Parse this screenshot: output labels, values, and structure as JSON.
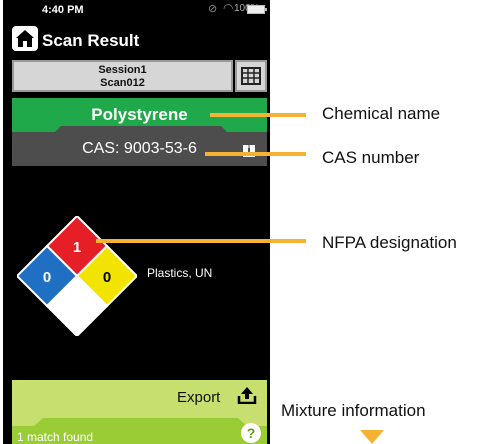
{
  "status_bar": {
    "time": "4:40 PM",
    "battery": "100%"
  },
  "header": {
    "title": "Scan Result"
  },
  "session": {
    "line1": "Session1",
    "line2": "Scan012"
  },
  "result": {
    "chemical_name": "Polystyrene",
    "cas": "CAS: 9003-53-6",
    "info_icon": "i"
  },
  "nfpa": {
    "health": "0",
    "flammability": "1",
    "instability": "0",
    "special": "",
    "label": "Plastics, UN",
    "colors": {
      "health": "#1f6fc2",
      "flammability": "#e61e25",
      "instability": "#f2e400",
      "special": "#ffffff"
    }
  },
  "footer": {
    "export_label": "Export",
    "match_text": "1 match found",
    "help_icon": "?"
  },
  "annotations": {
    "chemical_name": "Chemical name",
    "cas_number": "CAS number",
    "nfpa": "NFPA designation",
    "mixture": "Mixture information"
  },
  "colors": {
    "annotation_line": "#f6b232",
    "primary_green": "#1fa94a",
    "export_bar": "#c6df6f",
    "match_bar": "#99cc35"
  }
}
